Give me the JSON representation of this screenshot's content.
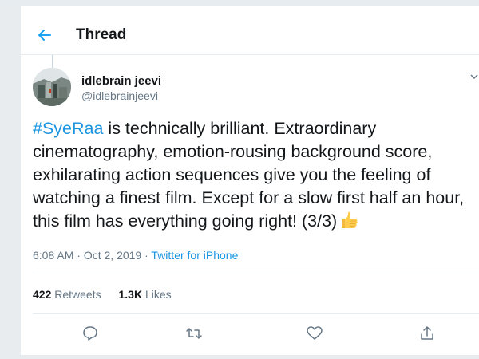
{
  "header": {
    "title": "Thread"
  },
  "tweet": {
    "author": {
      "display_name": "idlebrain jeevi",
      "handle": "@idlebrainjeevi"
    },
    "hashtag": "#SyeRaa",
    "text": " is technically brilliant. Extraordinary cinematography, emotion-rousing background score, exhilarating action sequences give you the feeling of watching a finest film. Except for a slow first half an hour, this film has everything going right! (3/3)",
    "emoji": "thumbs-up",
    "time": "6:08 AM",
    "separator1": " · ",
    "date": "Oct 2, 2019",
    "separator2": " · ",
    "source": "Twitter for iPhone"
  },
  "stats": {
    "retweets_count": "422",
    "retweets_label": "Retweets",
    "likes_count": "1.3K",
    "likes_label": "Likes"
  },
  "icons": {
    "back": "back-arrow-icon",
    "caret": "chevron-down-icon",
    "reply": "reply-icon",
    "retweet": "retweet-icon",
    "like": "heart-icon",
    "share": "share-icon"
  },
  "colors": {
    "accent": "#1da1f2",
    "link": "#1b95e0",
    "text": "#14171a",
    "secondary": "#657786",
    "border": "#e6ecf0"
  }
}
